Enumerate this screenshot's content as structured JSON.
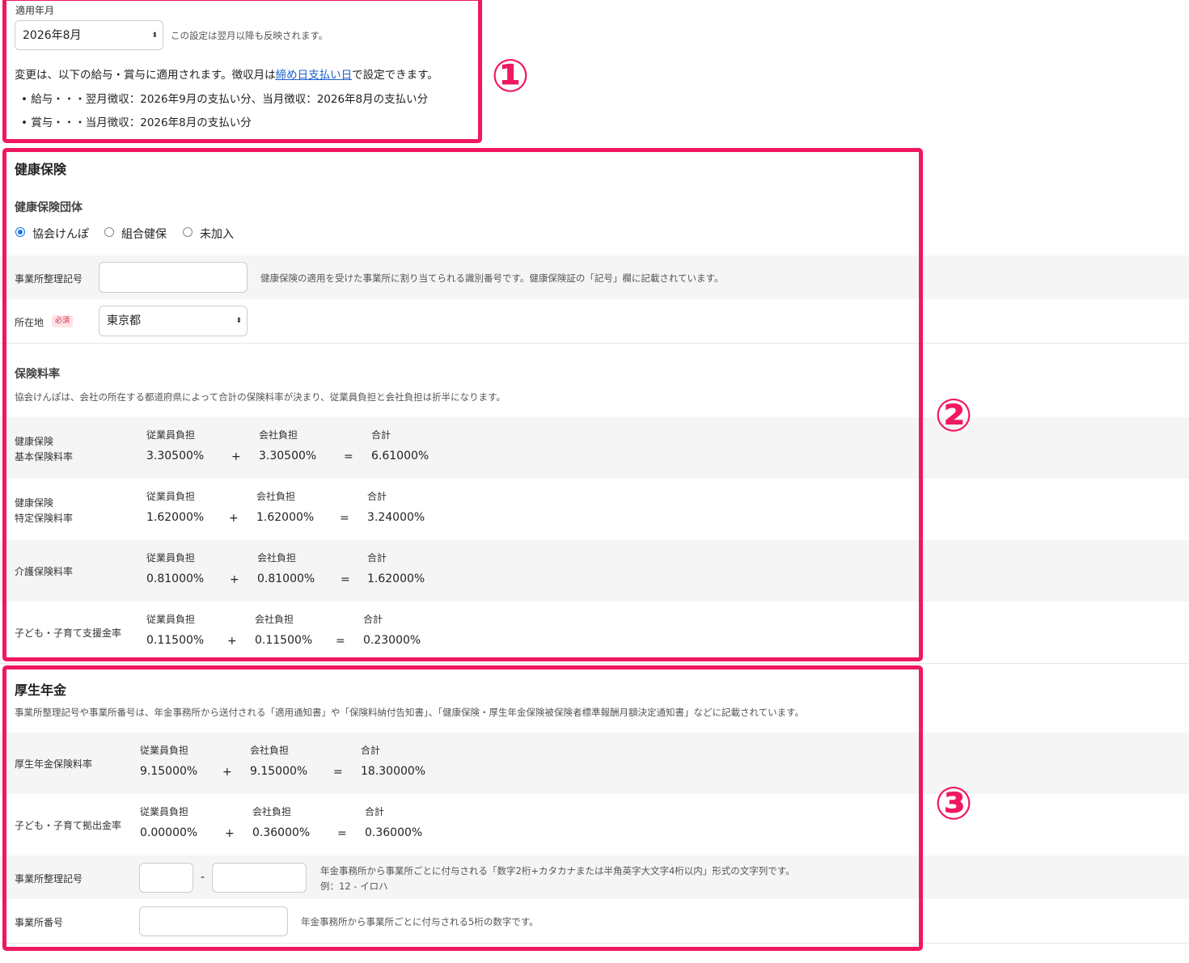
{
  "month": {
    "label": "適用年月",
    "selected": "2026年8月",
    "note": "この設定は翌月以降も反映されます。",
    "desc_before": "変更は、以下の給与・賞与に適用されます。徴収月は",
    "desc_link": "締め日支払い日",
    "desc_after": "で設定できます。",
    "bullet1": "• 給与・・・翌月徴収：2026年9月の支払い分、当月徴収：2026年8月の支払い分",
    "bullet2": "• 賞与・・・当月徴収：2026年8月の支払い分"
  },
  "markers": {
    "one": "①",
    "two": "②",
    "three": "③"
  },
  "health": {
    "title": "健康保険",
    "group_title": "健康保険団体",
    "radios": [
      "協会けんぽ",
      "組合健保",
      "未加入"
    ],
    "office_code_label": "事業所整理記号",
    "office_code_hint": "健康保険の適用を受けた事業所に割り当てられる識別番号です。健康保険証の「記号」欄に記載されています。",
    "location_label": "所在地",
    "required_badge": "必須",
    "location_value": "東京都",
    "rate_title": "保険料率",
    "rate_desc": "協会けんぽは、会社の所在する都道府県によって合計の保険料率が決まり、従業員負担と会社負担は折半になります。",
    "rates": [
      {
        "label1": "健康保険",
        "label2": "基本保険料率",
        "employee": "3.30500%",
        "company": "3.30500%",
        "total": "6.61000%"
      },
      {
        "label1": "健康保険",
        "label2": "特定保険料率",
        "employee": "1.62000%",
        "company": "1.62000%",
        "total": "3.24000%"
      },
      {
        "label1": "介護保険料率",
        "label2": "",
        "employee": "0.81000%",
        "company": "0.81000%",
        "total": "1.62000%"
      },
      {
        "label1": "子ども・子育て支援金率",
        "label2": "",
        "employee": "0.11500%",
        "company": "0.11500%",
        "total": "0.23000%"
      }
    ]
  },
  "col": {
    "employee": "従業員負担",
    "company": "会社負担",
    "total": "合計",
    "plus": "+",
    "equals": "="
  },
  "pension": {
    "title": "厚生年金",
    "desc": "事業所整理記号や事業所番号は、年金事務所から送付される「適用通知書」や「保険料納付告知書」、「健康保険・厚生年金保険被保険者標準報酬月額決定通知書」などに記載されています。",
    "rates": [
      {
        "label1": "厚生年金保険料率",
        "employee": "9.15000%",
        "company": "9.15000%",
        "total": "18.30000%"
      },
      {
        "label1": "子ども・子育て拠出金率",
        "employee": "0.00000%",
        "company": "0.36000%",
        "total": "0.36000%"
      }
    ],
    "office_code_label": "事業所整理記号",
    "dash": "-",
    "office_code_hint1": "年金事務所から事業所ごとに付与される「数字2桁+カタカナまたは半角英字大文字4桁以内」形式の文字列です。",
    "office_code_hint2": "例：12 - イロハ",
    "office_number_label": "事業所番号",
    "office_number_hint": "年金事務所から事業所ごとに付与される5桁の数字です。"
  },
  "colors": {
    "highlight": "#f0185f",
    "link": "#1a5fd1",
    "radio": "#1a73e8"
  }
}
